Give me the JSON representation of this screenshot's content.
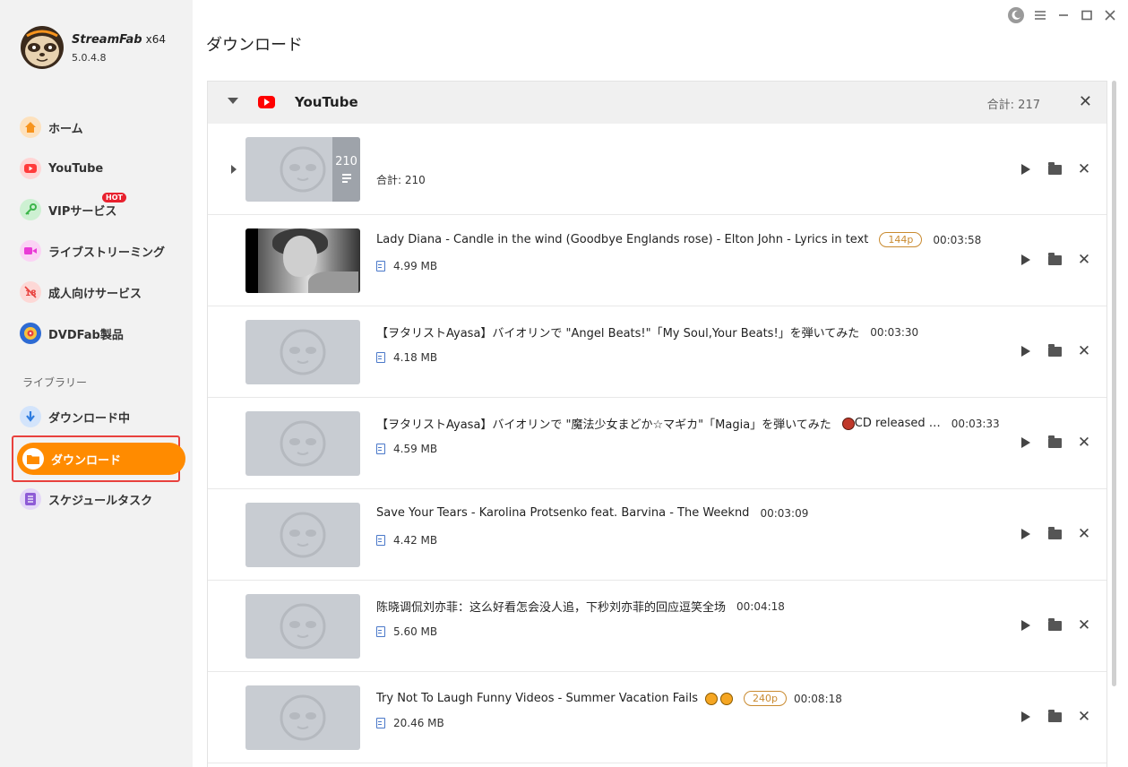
{
  "app": {
    "name": "StreamFab",
    "arch": "x64",
    "version": "5.0.4.8"
  },
  "sidebar": {
    "items": [
      {
        "label": "ホーム",
        "icon": "home-icon",
        "color": "#f7941d"
      },
      {
        "label": "YouTube",
        "icon": "youtube-icon",
        "color": "#ff3b3b"
      },
      {
        "label": "VIPサービス",
        "icon": "key-icon",
        "color": "#3cb54a",
        "badge": "HOT"
      },
      {
        "label": "ライブストリーミング",
        "icon": "video-camera-icon",
        "color": "#e93bd6"
      },
      {
        "label": "成人向けサービス",
        "icon": "no-adult-icon",
        "color": "#e8413d"
      },
      {
        "label": "DVDFab製品",
        "icon": "dvdfab-icon",
        "color": "#2e6bd3"
      }
    ],
    "library_title": "ライブラリー",
    "library": [
      {
        "label": "ダウンロード中",
        "icon": "download-arrow-icon",
        "color": "#2e7ce0"
      },
      {
        "label": "ダウンロード",
        "icon": "folder-icon",
        "color": "#ff8b00",
        "active": true
      },
      {
        "label": "スケジュールタスク",
        "icon": "schedule-list-icon",
        "color": "#8e5bd6"
      }
    ]
  },
  "header": {
    "title": "ダウンロード"
  },
  "group": {
    "title": "YouTube",
    "total": "合計: 217"
  },
  "rows": [
    {
      "type": "playlist",
      "count": "210",
      "total": "合計: 210"
    },
    {
      "title": "Lady Diana - Candle in the wind (Goodbye Englands rose) - Elton John - Lyrics in text",
      "res": "144p",
      "duration": "00:03:58",
      "size": "4.99 MB",
      "thumb": "photo"
    },
    {
      "title": "【ヲタリストAyasa】バイオリンで \"Angel Beats!\"「My Soul,Your Beats!」を弾いてみた",
      "duration": "00:03:30",
      "size": "4.18 MB"
    },
    {
      "title": "【ヲタリストAyasa】バイオリンで \"魔法少女まどか☆マギカ\"「Magia」を弾いてみた",
      "title_tail": "CD released …",
      "duration": "00:03:33",
      "size": "4.59 MB"
    },
    {
      "title": "Save Your Tears - Karolina Protsenko feat. Barvina - The Weeknd",
      "duration": "00:03:09",
      "size": "4.42 MB"
    },
    {
      "title": "陈晓调侃刘亦菲：这么好看怎会没人追，下秒刘亦菲的回应逗笑全场",
      "duration": "00:04:18",
      "size": "5.60 MB"
    },
    {
      "title": "Try Not To Laugh Funny Videos - Summer Vacation Fails",
      "res": "240p",
      "duration": "00:08:18",
      "size": "20.46 MB"
    }
  ],
  "colors": {
    "accent": "#ff8b00",
    "highlight_border": "#e8413d",
    "res_badge": "#c98a2f"
  }
}
